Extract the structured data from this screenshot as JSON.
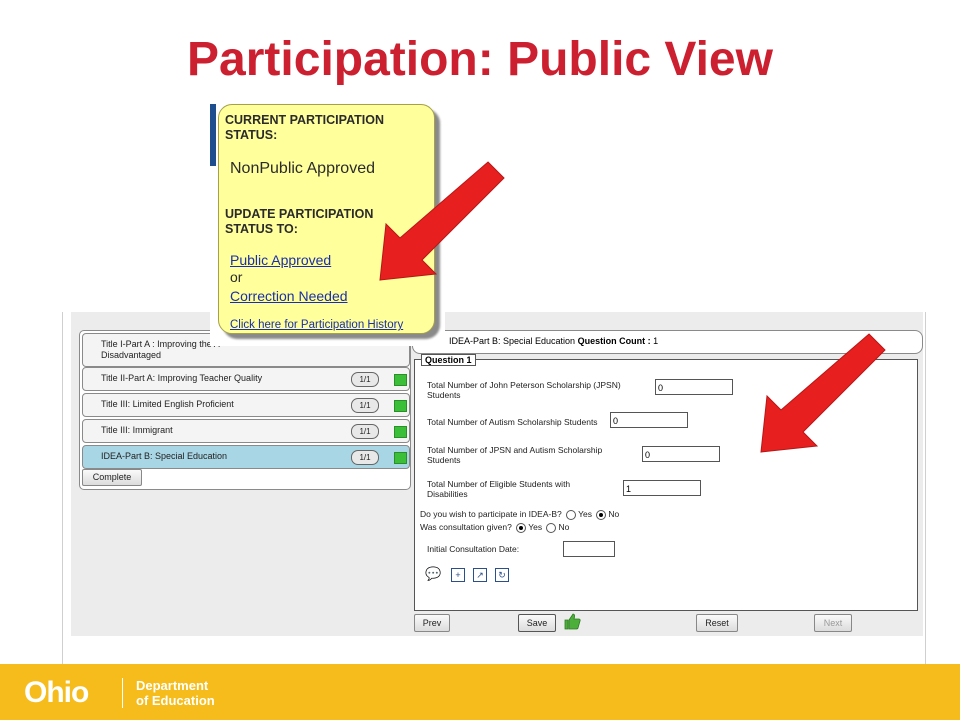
{
  "slide": {
    "title": "Participation:  Public View"
  },
  "programs": [
    {
      "label": "Title I-Part A : Improving the A",
      "label2": "Disadvantaged",
      "count": ""
    },
    {
      "label": "Title II-Part A: Improving Teacher Quality",
      "count": "1/1"
    },
    {
      "label": "Title III: Limited English Proficient",
      "count": "1/1"
    },
    {
      "label": "Title III: Immigrant",
      "count": "1/1"
    },
    {
      "label": "IDEA-Part B: Special Education",
      "count": "1/1"
    }
  ],
  "complete_label": "Complete",
  "header": {
    "program": "IDEA-Part B: Special Education",
    "count_label": "Question Count :",
    "count_value": "1"
  },
  "question": {
    "legend": "Question 1",
    "fields": [
      {
        "label": "Total Number of John Peterson Scholarship (JPSN) Students",
        "value": "0"
      },
      {
        "label": "Total Number of Autism Scholarship Students",
        "value": "0"
      },
      {
        "label": "Total Number of JPSN and Autism Scholarship Students",
        "value": "0"
      },
      {
        "label": "Total Number of Eligible Students with Disabilities",
        "value": "1"
      }
    ],
    "participate_q": "Do you wish to participate in IDEA-B?",
    "consult_q": "Was consultation given?",
    "yes": "Yes",
    "no": "No",
    "participate_value": "No",
    "consult_value": "Yes",
    "date_label": "Initial Consultation Date:",
    "date_value": ""
  },
  "nav": {
    "prev": "Prev",
    "save": "Save",
    "reset": "Reset",
    "next": "Next"
  },
  "popup": {
    "current_heading_1": "CURRENT PARTICIPATION",
    "current_heading_2": "STATUS:",
    "current_value": "NonPublic Approved",
    "update_heading_1": "UPDATE PARTICIPATION",
    "update_heading_2": "STATUS TO:",
    "option_1": "Public Approved",
    "or": "or",
    "option_2": "Correction Needed",
    "history_link": "Click here for Participation History"
  },
  "footer": {
    "logo": "Ohio",
    "dept_line1": "Department",
    "dept_line2": "of Education"
  },
  "colors": {
    "title_red": "#cc1f2f",
    "footer_gold": "#f6bc1b",
    "popup_yellow": "#ffff9c",
    "arrow_red": "#e81f1f"
  }
}
